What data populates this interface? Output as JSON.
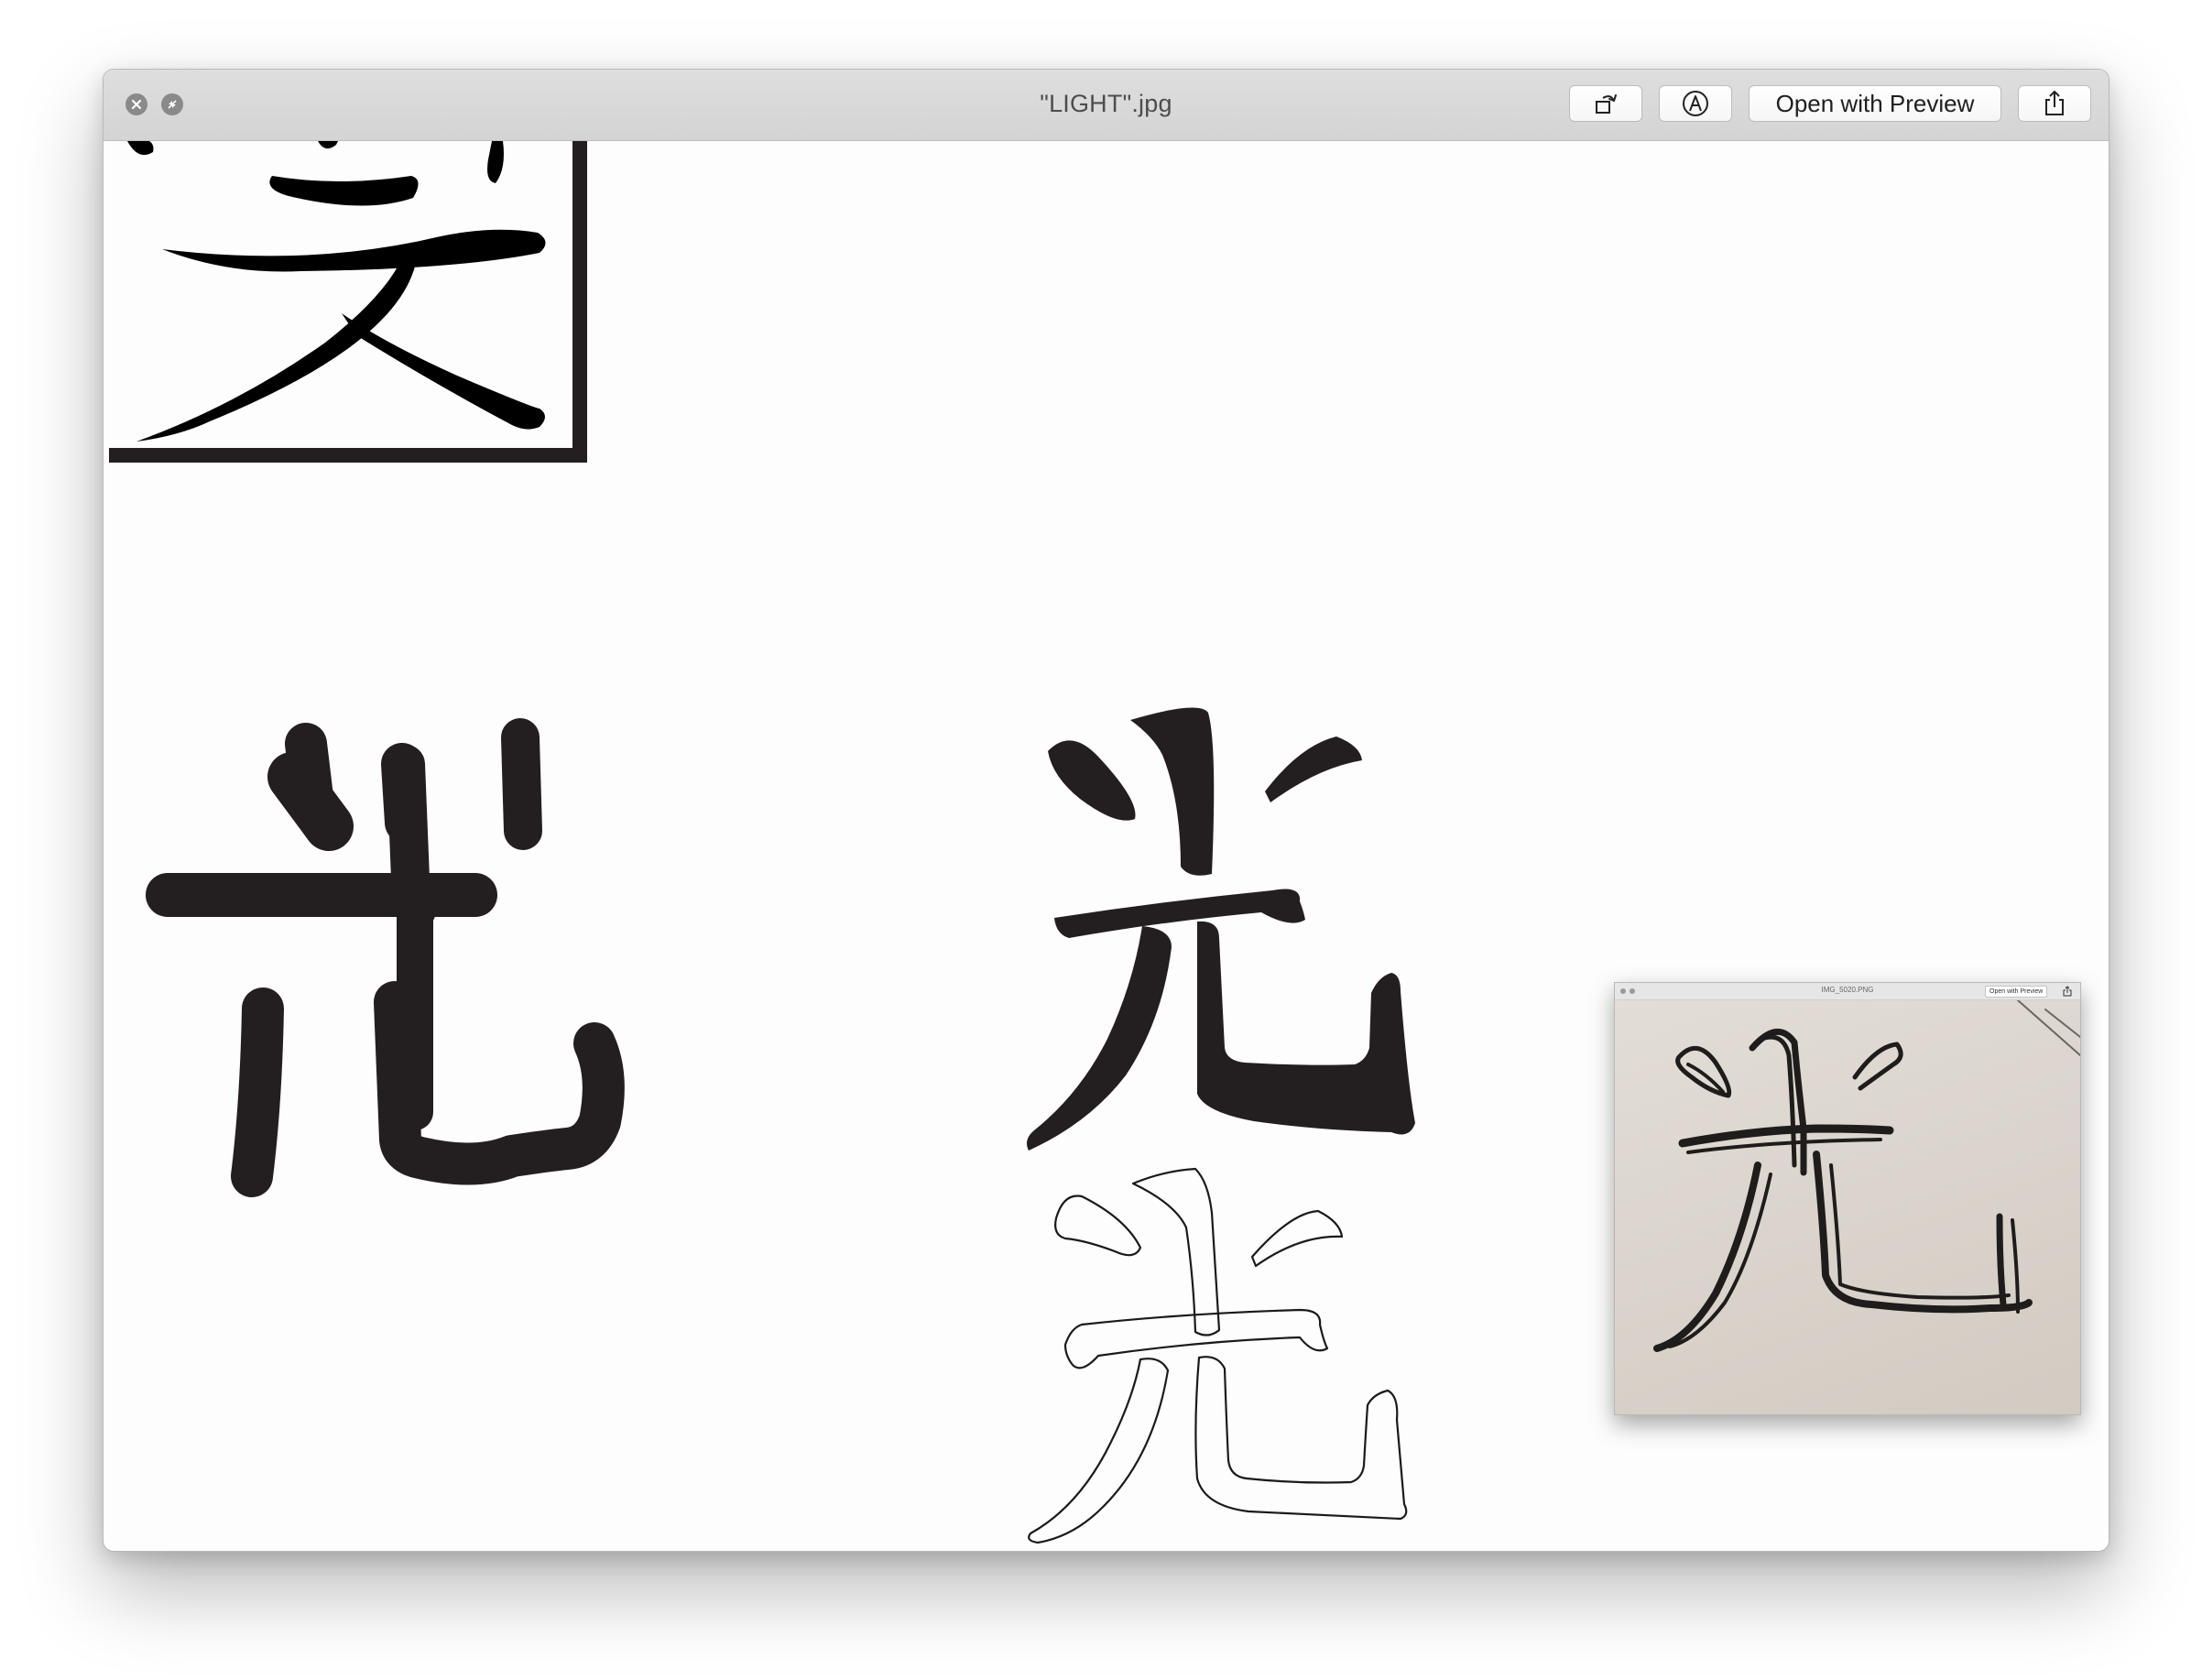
{
  "window": {
    "title": "\"LIGHT\".jpg",
    "buttons": {
      "rotate": "rotate-icon",
      "markup": "markup-icon",
      "open_with_preview": "Open with Preview",
      "share": "share-icon"
    }
  },
  "thumbnail": {
    "title": "IMG_5020.PNG",
    "open_label": "Open with Preview"
  },
  "colors": {
    "ink": "#231f20",
    "titlebar": "#d8d8d8",
    "traffic": "#8a8a8a"
  }
}
